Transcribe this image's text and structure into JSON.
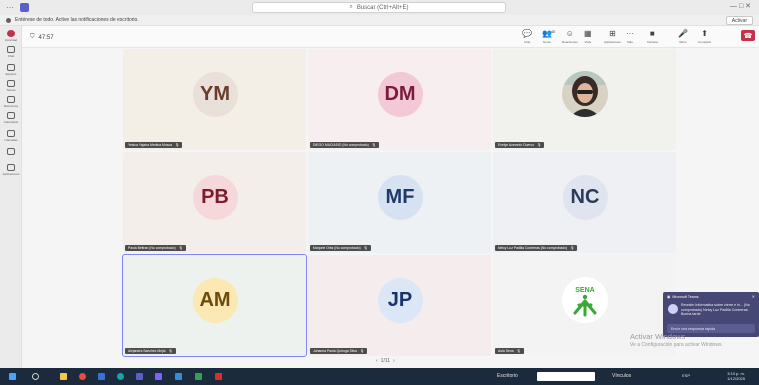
{
  "titlebar": {
    "dots": "···",
    "search_text": "Buscar (Ctrl+Alt+E)",
    "window_controls": "— □ ✕"
  },
  "notification": {
    "text": "Entérese de todo. Active las notificaciones de escritorio.",
    "button": "Activar"
  },
  "rail": [
    {
      "label": "Actividad",
      "icon": "bell-icon"
    },
    {
      "label": "Chat",
      "icon": "chat-icon"
    },
    {
      "label": "Equipos",
      "icon": "teams-icon"
    },
    {
      "label": "Tareas",
      "icon": "tasks-icon"
    },
    {
      "label": "Reuniones",
      "icon": "meetings-icon"
    },
    {
      "label": "Calendario",
      "icon": "calendar-icon"
    },
    {
      "label": "Llamadas",
      "icon": "calls-icon"
    },
    {
      "label": "···",
      "icon": "more-icon"
    },
    {
      "label": "Aplicaciones",
      "icon": "apps-icon"
    }
  ],
  "meeting": {
    "timer": "47:57",
    "controls": [
      {
        "label": "Chat",
        "glyph": "💬",
        "icon": "chat-icon"
      },
      {
        "label": "Gente",
        "glyph": "👥",
        "icon": "people-icon",
        "count": "40"
      },
      {
        "label": "Reacciones",
        "glyph": "☺",
        "icon": "reactions-icon"
      },
      {
        "label": "Vista",
        "glyph": "▦",
        "icon": "view-icon"
      },
      {
        "label": "Aplicaciones",
        "glyph": "⊞",
        "icon": "apps-icon"
      },
      {
        "label": "Más",
        "glyph": "···",
        "icon": "more-icon"
      },
      {
        "label": "Cámara",
        "glyph": "■",
        "icon": "camera-icon"
      },
      {
        "label": "Micro",
        "glyph": "🎤",
        "icon": "mic-icon"
      },
      {
        "label": "Compartir",
        "glyph": "⬆",
        "icon": "share-icon"
      }
    ],
    "leave_label": "Salir"
  },
  "participants": [
    {
      "initials": "YM",
      "name": "Yesica Yajaira Medina Mosca",
      "bg": "#f4efe6",
      "avatar_bg": "#e9e0d9",
      "avatar_fg": "#6b3b2b",
      "type": "initials"
    },
    {
      "initials": "DM",
      "name": "DIEGO MACIASIO (No comprobado)",
      "bg": "#f7eef0",
      "avatar_bg": "#f3c9d7",
      "avatar_fg": "#7a1d3d",
      "type": "initials"
    },
    {
      "initials": "",
      "name": "Evelyn Acevedo Cuervo",
      "bg": "#f1f2ee",
      "avatar_bg": "#c9c4b8",
      "avatar_fg": "#333333",
      "type": "photo"
    },
    {
      "initials": "PB",
      "name": "Paola Beltran (No comprobado)",
      "bg": "#f4eeea",
      "avatar_bg": "#f6d8db",
      "avatar_fg": "#7a1d2d",
      "type": "initials"
    },
    {
      "initials": "MF",
      "name": "Marjorie Ortiz (No comprobado)",
      "bg": "#eef1f4",
      "avatar_bg": "#d6e2f2",
      "avatar_fg": "#1d3a6b",
      "type": "initials"
    },
    {
      "initials": "NC",
      "name": "Nelcy Luz Padilla Contreras (No comprobado)",
      "bg": "#eef0f3",
      "avatar_bg": "#dfe4ee",
      "avatar_fg": "#2b3b5b",
      "type": "initials"
    },
    {
      "initials": "AM",
      "name": "Alejandra Sanchez Mejia",
      "bg": "#eef2ef",
      "avatar_bg": "#fbe8b2",
      "avatar_fg": "#6b4a0b",
      "type": "initials",
      "spotlight": true
    },
    {
      "initials": "JP",
      "name": "Johanna Paola Quiroga Silva",
      "bg": "#f5eded",
      "avatar_bg": "#dbe7f6",
      "avatar_fg": "#17356b",
      "type": "initials"
    },
    {
      "initials": "",
      "name": "Aula Sena",
      "bg": "#f3f3f3",
      "avatar_bg": "#ffffff",
      "avatar_fg": "#39a935",
      "type": "logo",
      "logo_text": "SENA"
    }
  ],
  "pager": {
    "prev": "‹",
    "text": "1/11",
    "next": "›"
  },
  "toast": {
    "app": "Microsoft Teams",
    "close": "✕",
    "message": "Reunión Informativa sobre cierre e in... (No comprobado) Nelcy Luz Padilla Contreras: Buena tarde",
    "reply": "Envíe una respuesta rápida"
  },
  "watermark": {
    "line1": "Activar Windows",
    "line2": "Ve a Configuración para activar Windows."
  },
  "taskbar": {
    "escritorio": "Escritorio",
    "vinculos": "Vínculos",
    "lang": "ESP",
    "time": "3:10 p. m.",
    "date": "1/12/2025"
  }
}
